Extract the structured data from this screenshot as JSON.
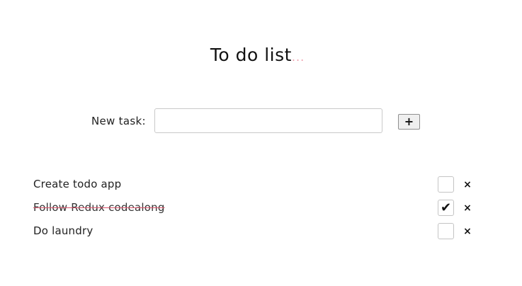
{
  "header": {
    "title": "To do list",
    "title_dots": "..."
  },
  "new_task": {
    "label": "New task:",
    "input_value": "",
    "add_button_label": "+"
  },
  "tasks": [
    {
      "text": "Create todo app",
      "done": false,
      "delete_label": "×"
    },
    {
      "text": "Follow Redux codealong",
      "done": true,
      "check_label": "✔",
      "delete_label": "×"
    },
    {
      "text": "Do laundry",
      "done": false,
      "delete_label": "×"
    }
  ],
  "colors": {
    "accent": "#f0a0ad",
    "strike": "#d9536a",
    "text": "#111111"
  },
  "icons": {
    "check": "check-icon",
    "delete": "close-icon",
    "add": "plus-icon"
  }
}
